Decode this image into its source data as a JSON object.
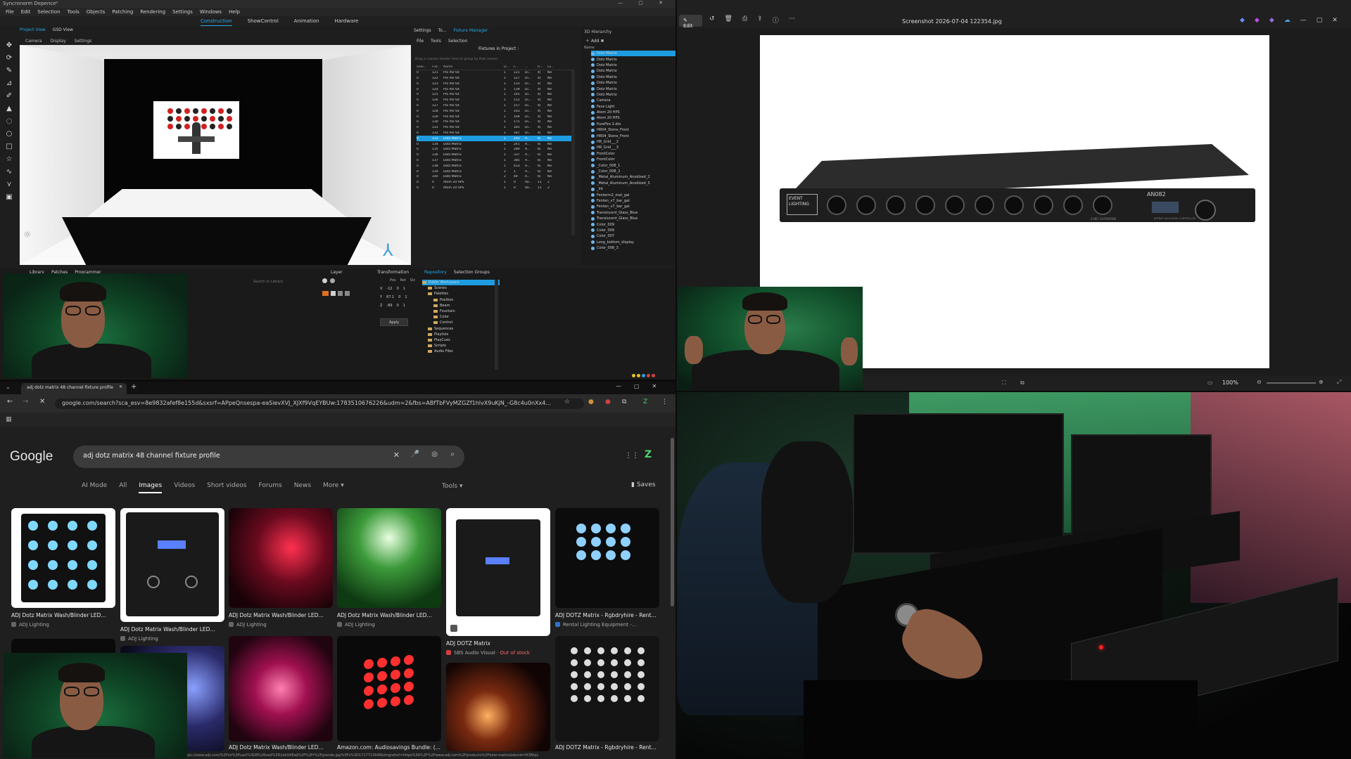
{
  "synco": {
    "title": "Syncronorm Depence²",
    "menu": [
      "File",
      "Edit",
      "Selection",
      "Tools",
      "Objects",
      "Patching",
      "Rendering",
      "Settings",
      "Windows",
      "Help"
    ],
    "modes": [
      "Construction",
      "ShowControl",
      "Animation",
      "Hardware"
    ],
    "view_tabs": [
      "Project View",
      "GSD View"
    ],
    "sub_tabs": [
      "Camera",
      "Display",
      "Settings"
    ],
    "fm_tabs": [
      "Settings",
      "To...",
      "Fixture Manager"
    ],
    "fm_sub": [
      "File",
      "Tools",
      "Selection"
    ],
    "fm_title": "Fixtures in Project :",
    "fm_hint": "Drag a column header here to group by that column",
    "fm_headers": [
      "Sele...",
      "Fixt...",
      "Name",
      "D...",
      "F...",
      "...",
      "R...",
      "Lo..."
    ],
    "fm_rows": [
      [
        "0",
        "121",
        "Pro Par 64",
        "1",
        "121",
        "Di...",
        "4(",
        "Ne"
      ],
      [
        "0",
        "122",
        "Pro Par 64",
        "1",
        "127",
        "Di...",
        "4(",
        "Ne"
      ],
      [
        "0",
        "123",
        "Pro Par 64",
        "1",
        "133",
        "Di...",
        "4(",
        "Ne"
      ],
      [
        "0",
        "124",
        "Pro Par 64",
        "1",
        "139",
        "Di...",
        "4(",
        "Ne"
      ],
      [
        "0",
        "125",
        "Pro Par 64",
        "1",
        "145",
        "Di...",
        "4(",
        "Ne"
      ],
      [
        "0",
        "126",
        "Pro Par 64",
        "1",
        "151",
        "Di...",
        "4(",
        "Ne"
      ],
      [
        "0",
        "127",
        "Pro Par 64",
        "1",
        "157",
        "Di...",
        "4(",
        "Ne"
      ],
      [
        "0",
        "128",
        "Pro Par 64",
        "1",
        "163",
        "Di...",
        "4(",
        "Ne"
      ],
      [
        "0",
        "129",
        "Pro Par 64",
        "1",
        "169",
        "Di...",
        "4(",
        "Ne"
      ],
      [
        "0",
        "130",
        "Pro Par 64",
        "1",
        "175",
        "Di...",
        "4(",
        "Ne"
      ],
      [
        "0",
        "131",
        "Pro Par 64",
        "1",
        "181",
        "Di...",
        "4(",
        "Ne"
      ],
      [
        "0",
        "132",
        "Pro Par 64",
        "1",
        "187",
        "Di...",
        "4(",
        "Ne"
      ],
      [
        "0",
        "133",
        "Dotz Matrix",
        "1",
        "193",
        "A...",
        "6(",
        "Ne"
      ],
      [
        "0",
        "134",
        "Dotz Matrix",
        "1",
        "241",
        "A...",
        "6(",
        "Ne"
      ],
      [
        "0",
        "135",
        "Dotz Matrix",
        "1",
        "289",
        "A...",
        "6(",
        "Ne"
      ],
      [
        "0",
        "136",
        "Dotz Matrix",
        "1",
        "337",
        "A...",
        "6(",
        "Ne"
      ],
      [
        "0",
        "137",
        "Dotz Matrix",
        "1",
        "385",
        "A...",
        "6(",
        "Ne"
      ],
      [
        "0",
        "138",
        "Dotz Matrix",
        "1",
        "433",
        "A...",
        "6(",
        "Ne"
      ],
      [
        "0",
        "139",
        "Dotz Matrix",
        "2",
        "1",
        "A...",
        "6(",
        "Ne"
      ],
      [
        "0",
        "140",
        "Dotz Matrix",
        "2",
        "49",
        "A...",
        "6(",
        "Ne"
      ],
      [
        "0",
        "0",
        "Atom 20 HPS",
        "1",
        "0",
        "Ro...",
        "11",
        "2"
      ],
      [
        "0",
        "0",
        "Atom 20 HPS",
        "1",
        "0",
        "Ro...",
        "11",
        "2"
      ]
    ],
    "hier_title": "3D Hierarchy",
    "hier_add": "Add",
    "hier_col": "Name",
    "hier_items": [
      "Dotz Matrix",
      "Dotz Matrix",
      "Dotz Matrix",
      "Dotz Matrix",
      "Dotz Matrix",
      "Dotz Matrix",
      "Dotz Matrix",
      "Dotz Matrix",
      "Camera",
      "Face Light",
      "Atom 20 HPS",
      "Atom 20 HPS",
      "PureFire 2.dtx",
      "HR04_Stone_Front",
      "HR04_Stone_Front",
      "HR_Grid___2",
      "HR_Grid___3",
      "FrontColor",
      "FrontColor",
      "_Color_008_1",
      "_Color_008_2",
      "_Metal_Aluminum_Anodized_2",
      "_Metal_Aluminum_Anodized_3",
      "_Int",
      "Fenterm2_mat_gal",
      "Fenten_v7_bar_gal",
      "Fenten_v7_bar_gal",
      "Translucent_Glass_Blue",
      "Translucent_Glass_Blue",
      "Color_009",
      "Color_009",
      "Color_007",
      "Long_bottom_display",
      "Color_008_3"
    ],
    "lib_tabs": [
      "Library",
      "Patches",
      "Programmer"
    ],
    "search_library": "Search in Library",
    "layer_title": "Layer",
    "transform_title": "Transformation",
    "transform_cols": [
      "Pos",
      "Rot",
      "Siz"
    ],
    "transform_rows": [
      [
        "X",
        "-12",
        "0",
        "1"
      ],
      [
        "Y",
        "67.1",
        "0",
        "1"
      ],
      [
        "Z",
        "-89",
        "0",
        "1"
      ]
    ],
    "apply": "Apply",
    "repo_tabs": [
      "Repository",
      "Selection Groups"
    ],
    "repo_items": [
      "Public Workspace",
      "Scenes",
      "Palettes",
      "Position",
      "Beam",
      "Fountain",
      "Color",
      "Control",
      "Sequences",
      "Playlists",
      "PlayCues",
      "Scripts",
      "Audio Files"
    ]
  },
  "viewer": {
    "edit": "Edit",
    "title": "Screenshot 2026-07-04 122354.jpg",
    "zoom": "100%",
    "device_brand": "EVENT LIGHTING",
    "device_model": "AN082",
    "device_label": "8 NET AUTOMODE",
    "device_small": "ARTNET AN 8 NODE CONTROLLER"
  },
  "chrome": {
    "tab_title": "adj dotz matrix 48 channel fixture profile",
    "url": "google.com/search?sca_esv=8e9832afef8e155d&sxsrf=APpeQnsespa-eaSievXVJ_XJXf9VqEYBUw:1783510676226&udm=2&fbs=ABfTbFVyMZGZf1hlvX9uKjN_-G8c4u0nXx4...",
    "google": "Google",
    "query": "adj dotz matrix 48 channel fixture profile",
    "tabs": [
      "AI Mode",
      "All",
      "Images",
      "Videos",
      "Short videos",
      "Forums",
      "News",
      "More"
    ],
    "tools": "Tools",
    "saves": "Saves",
    "results": [
      {
        "cap": "ADJ Dotz Matrix Wash/Blinder LED...",
        "src": "ADJ Lighting",
        "oos": ""
      },
      {
        "cap": "ADJ Dotz Matrix Wash/Blinder LED...",
        "src": "ADJ Lighting",
        "oos": ""
      },
      {
        "cap": "ADJ Dotz Matrix Wash/Blinder LED...",
        "src": "ADJ Lighting",
        "oos": ""
      },
      {
        "cap": "ADJ Dotz Matrix Wash/Blinder LED...",
        "src": "ADJ Lighting",
        "oos": ""
      },
      {
        "cap": "ADJ DOTZ Matrix",
        "src": "SBS Audio Visual",
        "oos": "Out of stock"
      },
      {
        "cap": "ADJ DOTZ Matrix - Rgbdryhire - Rent...",
        "src": "Rental Lighting Equipment -...",
        "oos": ""
      },
      {
        "cap": "ADJ Dotz Matrix Wash/Blinder LED...",
        "src": "",
        "oos": ""
      },
      {
        "cap": "Amazon.com: Audiosavings Bundle: (...",
        "src": "",
        "oos": ""
      },
      {
        "cap": "ADJ DOTZ Matrix - Rgbdryhire - Rent...",
        "src": "",
        "oos": ""
      }
    ],
    "status_url": "https://www.adj.com/%2Fslr%3Fuact%3D8%26ved%3D2ahUKEwj%2F%2Fr%2Fgrande.jpg%3Fv%3D1717713948&imgrefurl=https%3A%2F%2Fwww.adj.com%2Fproducts%2Fdotz-matrix&docid=fX3Nvjz"
  },
  "colors": {
    "accent": "#2aa7e8",
    "selection": "#1e9ce0",
    "webcam_green": "#1c6f3f"
  }
}
